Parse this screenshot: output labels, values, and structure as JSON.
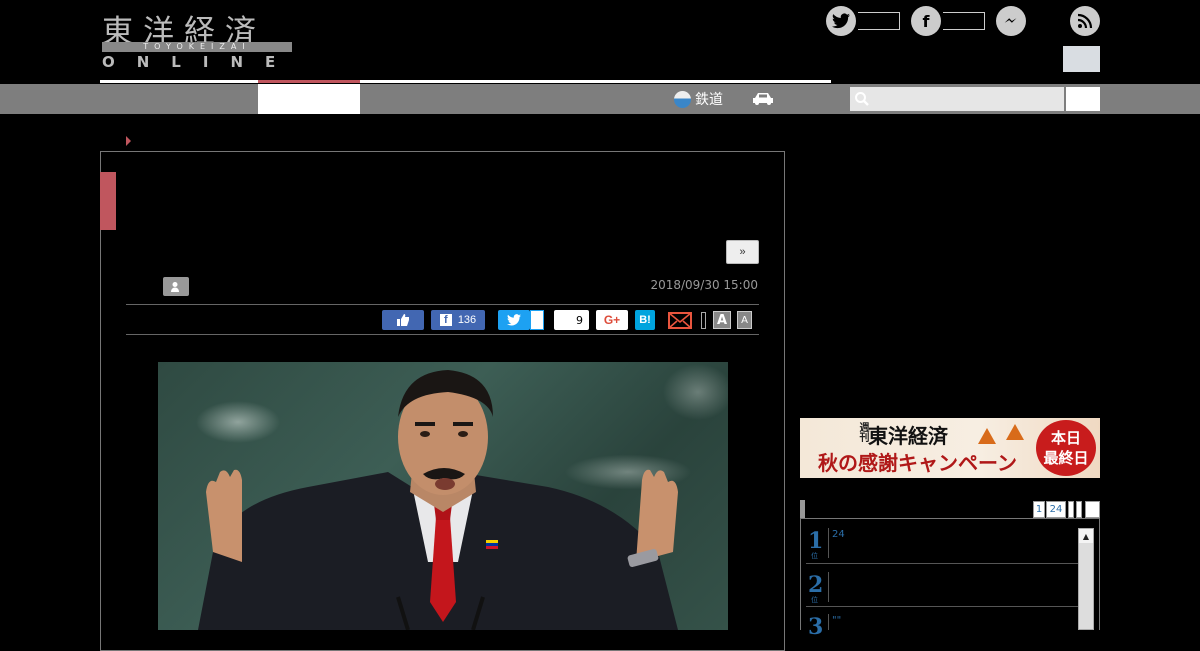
{
  "logo": {
    "top": "東洋経済",
    "band": "TOYOKEIZAI",
    "bottom": "ONLINE"
  },
  "social": {
    "twitter_icon": "twitter-icon",
    "facebook_icon": "facebook-icon",
    "messenger_icon": "messenger-icon",
    "rss_icon": "rss-icon"
  },
  "nav": {
    "railway_label": "鉄道",
    "car_icon": "car-icon"
  },
  "search": {
    "placeholder": ""
  },
  "article": {
    "next_label": "»",
    "date": "2018/09/30 15:00"
  },
  "share": {
    "facebook_count": "136",
    "pocket_count": "9",
    "gplus_label": "G+",
    "hatena_label": "B!",
    "font_large": "A",
    "font_small": "A"
  },
  "banner": {
    "small": "週刊",
    "title": "東洋経済",
    "subtitle": "秋の感謝キャンペーン",
    "badge_line1": "本日",
    "badge_line2": "最終日"
  },
  "ranking": {
    "tabs": [
      "1",
      "24"
    ],
    "items": [
      {
        "rank": "1",
        "suffix": "位",
        "text": "24"
      },
      {
        "rank": "2",
        "suffix": "位",
        "text": ""
      },
      {
        "rank": "3",
        "suffix": "",
        "text": "\"\""
      }
    ]
  },
  "colors": {
    "accent": "#c0565e",
    "facebook": "#4267b2",
    "twitter": "#1da1f2",
    "hatena": "#00a4de",
    "ranking_blue": "#2b6ea8"
  }
}
